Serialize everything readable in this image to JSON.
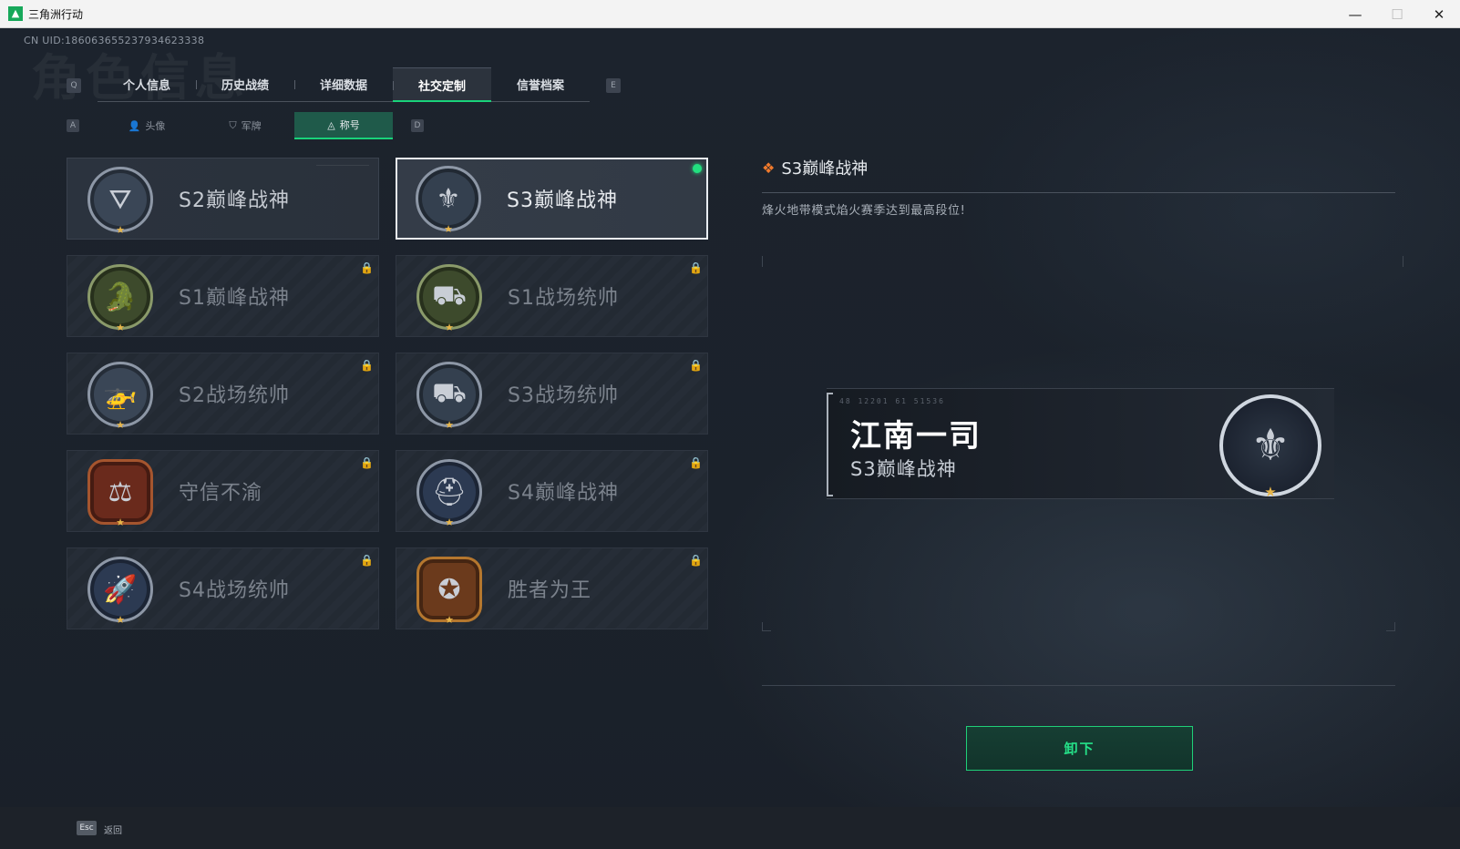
{
  "window": {
    "title": "三角洲行动",
    "min": "—",
    "max": "☐",
    "close": "✕"
  },
  "uid": "CN UID:18606365523793462333​8",
  "watermark": "角色信息",
  "tabs": {
    "left_key": "Q",
    "right_key": "E",
    "items": [
      {
        "label": "个人信息",
        "active": false
      },
      {
        "label": "历史战绩",
        "active": false
      },
      {
        "label": "详细数据",
        "active": false
      },
      {
        "label": "社交定制",
        "active": true
      },
      {
        "label": "信誉档案",
        "active": false
      }
    ]
  },
  "subtabs": {
    "left_key": "A",
    "right_key": "D",
    "items": [
      {
        "label": "头像",
        "icon": "person-icon",
        "glyph": "👤",
        "active": false
      },
      {
        "label": "军牌",
        "icon": "dogtag-icon",
        "glyph": "⛉",
        "active": false
      },
      {
        "label": "称号",
        "icon": "title-icon",
        "glyph": "◬",
        "active": true
      }
    ]
  },
  "titles": [
    {
      "name": "S2巅峰战神",
      "icon": "s2-peak-badge-icon",
      "glyph": "⛛",
      "color": "#3a4656",
      "locked": false,
      "selected": false
    },
    {
      "name": "S3巅峰战神",
      "icon": "s3-peak-badge-icon",
      "glyph": "⚜",
      "color": "#34404f",
      "locked": false,
      "selected": true
    },
    {
      "name": "S1巅峰战神",
      "icon": "crocodile-badge-icon",
      "glyph": "🐊",
      "color": "#3d4a2c",
      "locked": true,
      "selected": false
    },
    {
      "name": "S1战场统帅",
      "icon": "tank-badge-icon",
      "glyph": "⛟",
      "color": "#3d4a2c",
      "locked": true,
      "selected": false
    },
    {
      "name": "S2战场统帅",
      "icon": "helicopter-badge-icon",
      "glyph": "🚁",
      "color": "#3a4656",
      "locked": true,
      "selected": false
    },
    {
      "name": "S3战场统帅",
      "icon": "armored-vehicle-badge-icon",
      "glyph": "⛟",
      "color": "#34404f",
      "locked": true,
      "selected": false
    },
    {
      "name": "守信不渝",
      "icon": "scales-badge-icon",
      "glyph": "⚖",
      "color": "#6a2a1c",
      "locked": true,
      "selected": false
    },
    {
      "name": "S4巅峰战神",
      "icon": "helmet-badge-icon",
      "glyph": "⛑",
      "color": "#2c3a52",
      "locked": true,
      "selected": false
    },
    {
      "name": "S4战场统帅",
      "icon": "missile-badge-icon",
      "glyph": "🚀",
      "color": "#2c3a52",
      "locked": true,
      "selected": false
    },
    {
      "name": "胜者为王",
      "icon": "medal-badge-icon",
      "glyph": "✪",
      "color": "#6b3a1c",
      "locked": true,
      "selected": false
    }
  ],
  "lock_glyph": "🔒",
  "detail": {
    "icon_glyph": "❖",
    "title": "S3巅峰战神",
    "description": "烽火地带模式焰火赛季达到最高段位!"
  },
  "nameplate": {
    "code": "48 12201 61 51536",
    "player_name": "江南一司",
    "title": "S3巅峰战神",
    "badge_glyph": "⚜"
  },
  "unequip_button": "卸下",
  "footer": {
    "key": "Esc",
    "label": "返回"
  }
}
